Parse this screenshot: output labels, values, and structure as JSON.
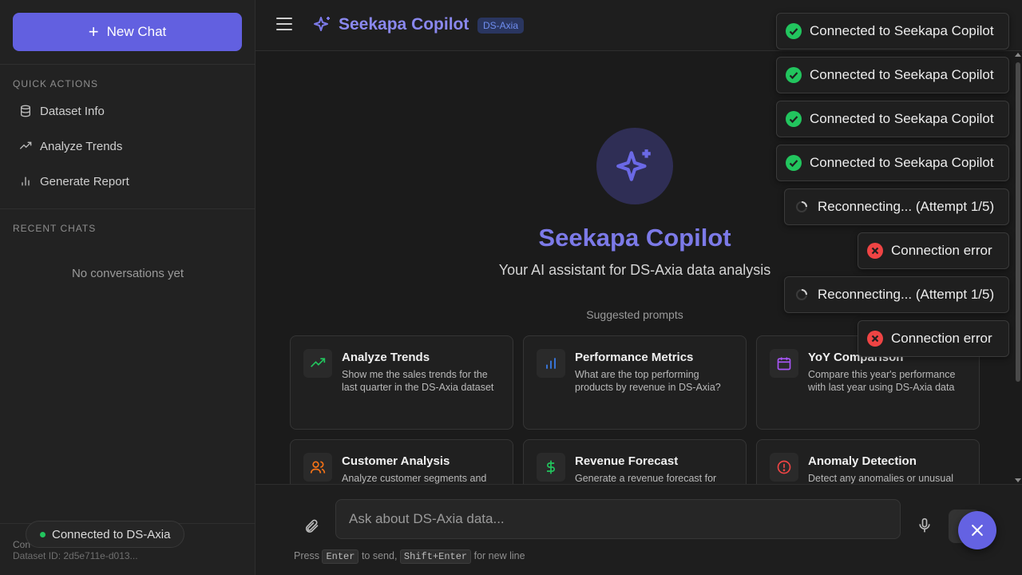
{
  "sidebar": {
    "new_chat_label": "New Chat",
    "quick_actions_title": "QUICK ACTIONS",
    "quick_actions": [
      {
        "label": "Dataset Info",
        "icon": "database-icon"
      },
      {
        "label": "Analyze Trends",
        "icon": "trend-icon"
      },
      {
        "label": "Generate Report",
        "icon": "bar-chart-icon"
      }
    ],
    "recent_chats_title": "RECENT CHATS",
    "recent_empty": "No conversations yet",
    "footer_status": "Con",
    "footer_dataset_id": "Dataset ID: 2d5e711e-d013...",
    "connection_pill": "Connected to DS-Axia"
  },
  "header": {
    "title": "Seekapa Copilot",
    "badge": "DS-Axia"
  },
  "hero": {
    "title": "Seekapa Copilot",
    "subtitle": "Your AI assistant for DS-Axia data analysis",
    "suggested_label": "Suggested prompts"
  },
  "cards": [
    {
      "title": "Analyze Trends",
      "desc": "Show me the sales trends for the last quarter in the DS-Axia dataset",
      "icon": "trend-icon",
      "color": "#22c55e"
    },
    {
      "title": "Performance Metrics",
      "desc": "What are the top performing products by revenue in DS-Axia?",
      "icon": "bar-chart-icon",
      "color": "#3b82f6"
    },
    {
      "title": "YoY Comparison",
      "desc": "Compare this year's performance with last year using DS-Axia data",
      "icon": "calendar-icon",
      "color": "#a855f7"
    },
    {
      "title": "Customer Analysis",
      "desc": "Analyze customer segments and",
      "icon": "users-icon",
      "color": "#f97316"
    },
    {
      "title": "Revenue Forecast",
      "desc": "Generate a revenue forecast for",
      "icon": "dollar-icon",
      "color": "#22c55e"
    },
    {
      "title": "Anomaly Detection",
      "desc": "Detect any anomalies or unusual",
      "icon": "alert-icon",
      "color": "#ef4444"
    }
  ],
  "composer": {
    "placeholder": "Ask about DS-Axia data...",
    "hint_press": "Press",
    "hint_enter": "Enter",
    "hint_to_send": "to send,",
    "hint_shift_enter": "Shift+Enter",
    "hint_new_line": "for new line"
  },
  "toasts": [
    {
      "type": "success",
      "text": "Connected to Seekapa Copilot"
    },
    {
      "type": "success",
      "text": "Connected to Seekapa Copilot"
    },
    {
      "type": "success",
      "text": "Connected to Seekapa Copilot"
    },
    {
      "type": "success",
      "text": "Connected to Seekapa Copilot"
    },
    {
      "type": "loading",
      "text": "Reconnecting... (Attempt 1/5)"
    },
    {
      "type": "error",
      "text": "Connection error"
    },
    {
      "type": "loading",
      "text": "Reconnecting... (Attempt 1/5)"
    },
    {
      "type": "error",
      "text": "Connection error"
    }
  ],
  "colors": {
    "accent": "#6260e0",
    "success": "#22c55e",
    "error": "#ef4444",
    "brand_text": "#8a88ee"
  }
}
